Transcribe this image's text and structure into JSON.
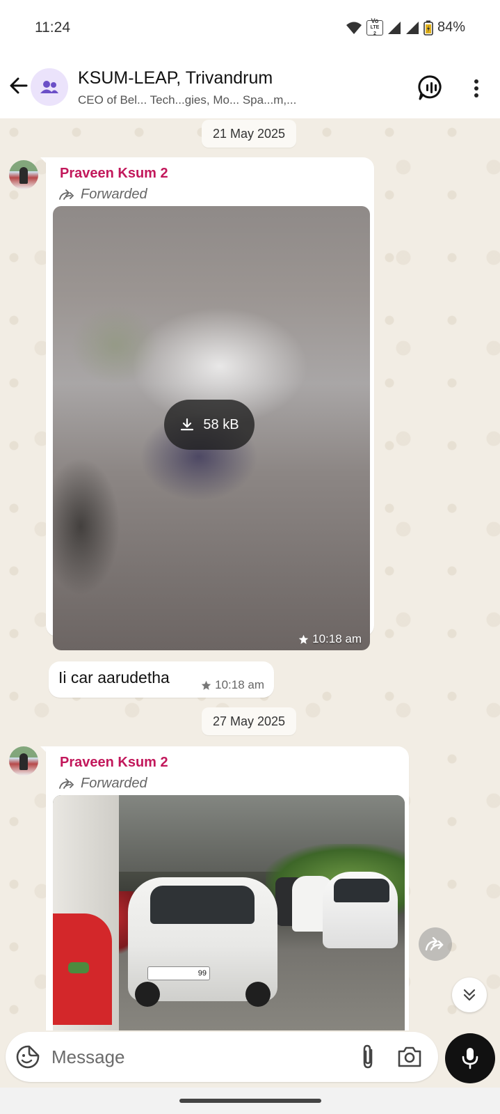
{
  "status_bar": {
    "time": "11:24",
    "battery": "84%",
    "volte_top": "Vo",
    "volte_bottom": "LTE 2"
  },
  "header": {
    "title": "KSUM-LEAP, Trivandrum",
    "subtitle": "CEO of Bel... Tech...gies, Mo... Spa...m,..."
  },
  "messages": [
    {
      "date": "21 May 2025",
      "sender": "Praveen Ksum 2",
      "forwarded_label": "Forwarded",
      "media_size": "58 kB",
      "media_time": "10:18 am",
      "reply_text": "Ii car aarudetha",
      "reply_time": "10:18 am"
    },
    {
      "date": "27 May 2025",
      "sender": "Praveen Ksum 2",
      "forwarded_label": "Forwarded",
      "plate_text": "99"
    }
  ],
  "composer": {
    "placeholder": "Message"
  },
  "icons": {
    "back": "back-arrow-icon",
    "group": "group-icon",
    "call": "voice-chat-icon",
    "more": "more-vert-icon",
    "forward": "forward-icon",
    "download": "download-icon",
    "star": "star-icon",
    "sticker": "sticker-icon",
    "attach": "attach-icon",
    "camera": "camera-icon",
    "mic": "mic-icon",
    "scroll_down": "double-chevron-down-icon"
  },
  "colors": {
    "sender_name": "#c2185b",
    "wallpaper": "#f2ede4",
    "mic_button": "#111111"
  }
}
